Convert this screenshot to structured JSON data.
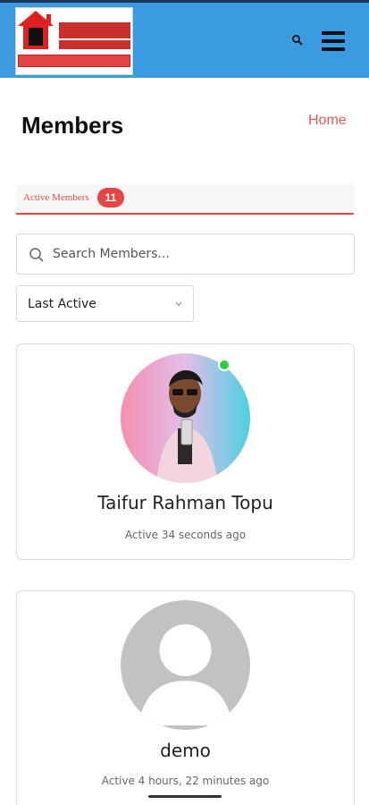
{
  "header": {
    "logo_alt": "site logo",
    "search_icon": "search-icon",
    "menu_icon": "hamburger-menu-icon"
  },
  "page": {
    "title": "Members",
    "home_link": "Home"
  },
  "tabs": {
    "active_label": "Active Members",
    "active_count": "11"
  },
  "search": {
    "placeholder": "Search Members..."
  },
  "sort": {
    "selected": "Last Active"
  },
  "members": [
    {
      "name": "Taifur Rahman Topu",
      "last_active": "Active 34 seconds ago",
      "online": true
    },
    {
      "name": "demo",
      "last_active": "Active 4 hours, 22 minutes ago",
      "online": false
    }
  ],
  "colors": {
    "header_bg": "#3a9be0",
    "accent": "#e64545",
    "online": "#2ecc40"
  }
}
